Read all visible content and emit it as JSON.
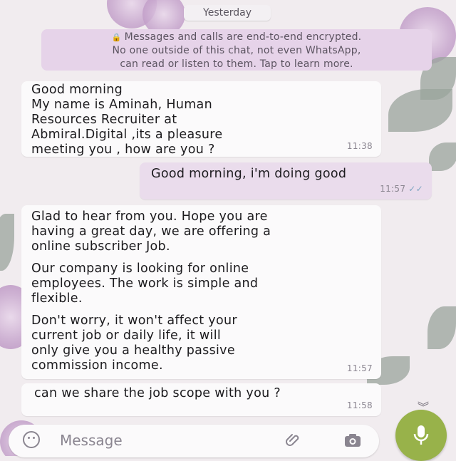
{
  "date_separator": "Yesterday",
  "encryption_notice": [
    "Messages and calls are end-to-end encrypted.",
    "No one outside of this chat, not even WhatsApp,",
    "can read or listen to them. Tap to learn more."
  ],
  "messages": [
    {
      "direction": "incoming",
      "lines": [
        "Good morning",
        "My name is Aminah, Human",
        "Resources Recruiter at",
        "Abmiral.Digital ,its a pleasure",
        "meeting you , how are you ?"
      ],
      "time": "11:38"
    },
    {
      "direction": "outgoing",
      "lines": [
        "Good morning, i'm doing good"
      ],
      "time": "11:57",
      "status": "read"
    },
    {
      "direction": "incoming",
      "paragraphs": [
        [
          "Glad to hear from you. Hope you are",
          "having a great day, we are offering a",
          "online subscriber Job."
        ],
        [
          "Our company is looking for online",
          "employees. The work is simple and",
          "flexible."
        ],
        [
          "Don't worry, it won't affect your",
          "current job or daily life, it will",
          "only give you a healthy passive",
          "commission income."
        ]
      ],
      "time": "11:57"
    },
    {
      "direction": "incoming",
      "lines": [
        "can we share the job scope with you ?"
      ],
      "time": "11:58"
    }
  ],
  "composer": {
    "placeholder": "Message",
    "icons": [
      "emoji-icon",
      "attach-icon",
      "camera-icon",
      "mic-icon"
    ]
  },
  "scroll_down_icon": "chevron-double-down-icon",
  "colors": {
    "outgoing_bubble": "#eadcec",
    "incoming_bubble": "#fbfafb",
    "notice_bg": "#e6d3e9",
    "mic_button": "#98b24a",
    "read_ticks": "#7fa5c2"
  }
}
